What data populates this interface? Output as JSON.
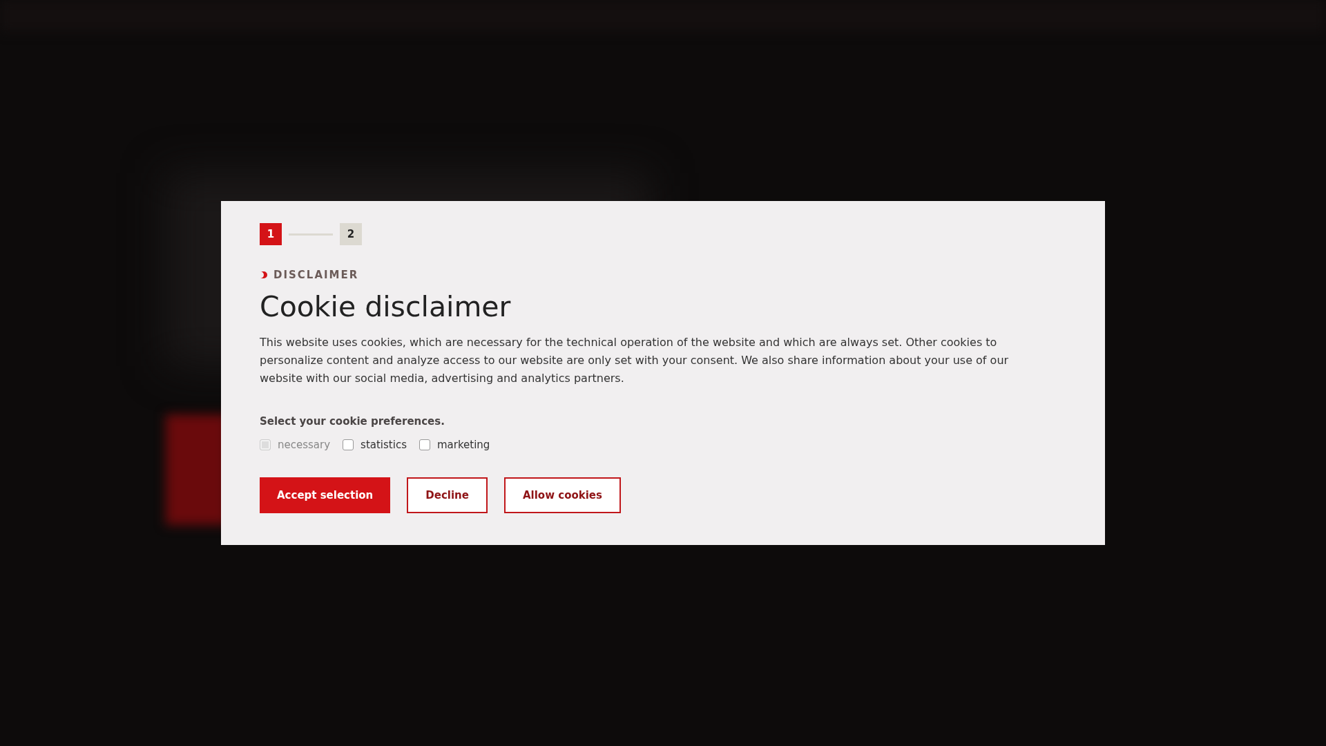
{
  "steps": [
    {
      "label": "1",
      "selected": true
    },
    {
      "label": "2",
      "selected": false
    }
  ],
  "eyebrow": "DISCLAIMER",
  "title": "Cookie disclaimer",
  "text": "This website uses cookies, which are necessary for the technical operation of the website and which are always set. Other cookies to personalize content and analyze access to our website are only set with your consent. We also share information about your use of our website with our social media, advertising and analytics partners.",
  "preferences_label": "Select your cookie preferences.",
  "options": [
    {
      "label": "necessary",
      "checked": true,
      "disabled": true
    },
    {
      "label": "statistics",
      "checked": false,
      "disabled": false
    },
    {
      "label": "marketing",
      "checked": false,
      "disabled": false
    }
  ],
  "buttons": [
    {
      "label": "Accept selection",
      "kind": "primary"
    },
    {
      "label": "Decline",
      "kind": "outline"
    },
    {
      "label": "Allow cookies",
      "kind": "outline"
    }
  ]
}
